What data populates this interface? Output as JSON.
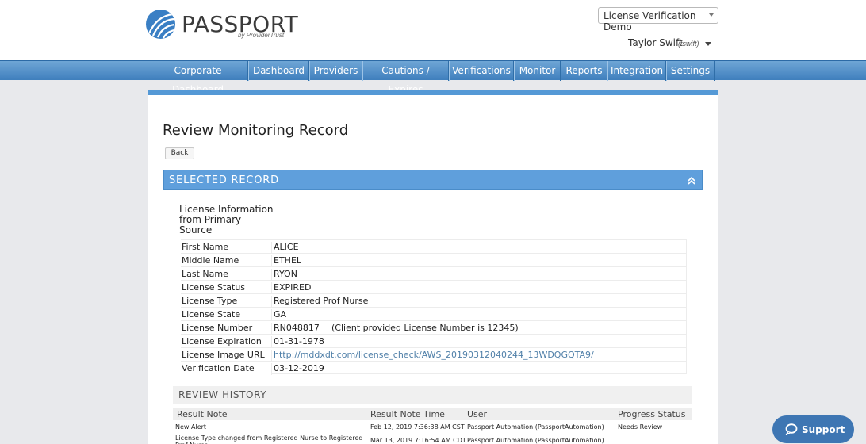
{
  "brand": {
    "name": "PASSPORT",
    "tagline": "by ProviderTrust"
  },
  "account": {
    "selected": "License Verification Demo"
  },
  "user": {
    "name": "Taylor Swift",
    "handle": "(tswift)"
  },
  "nav": [
    {
      "label": "Corporate Dashboard"
    },
    {
      "label": "Dashboard"
    },
    {
      "label": "Providers"
    },
    {
      "label": "Cautions / Expires"
    },
    {
      "label": "Verifications"
    },
    {
      "label": "Monitor"
    },
    {
      "label": "Reports"
    },
    {
      "label": "Integration"
    },
    {
      "label": "Settings"
    }
  ],
  "page": {
    "title": "Review Monitoring Record",
    "back_label": "Back"
  },
  "selected_record": {
    "title": "SELECTED RECORD",
    "heading": "License Information from Primary Source",
    "fields": [
      {
        "label": "First Name",
        "value": "ALICE"
      },
      {
        "label": "Middle Name",
        "value": "ETHEL"
      },
      {
        "label": "Last Name",
        "value": "RYON"
      },
      {
        "label": "License Status",
        "value": "EXPIRED"
      },
      {
        "label": "License Type",
        "value": "Registered Prof Nurse"
      },
      {
        "label": "License State",
        "value": "GA"
      },
      {
        "label": "License Number",
        "value": "RN048817",
        "extra": "(Client provided License Number is 12345)"
      },
      {
        "label": "License Expiration",
        "value": "01-31-1978"
      },
      {
        "label": "License Image URL",
        "value": "http://mddxdt.com/license_check/AWS_20190312040244_13WDQGQTA9/"
      },
      {
        "label": "Verification Date",
        "value": "03-12-2019"
      }
    ]
  },
  "review_history": {
    "title": "REVIEW HISTORY",
    "columns": [
      "Result Note",
      "Result Note Time",
      "User",
      "Progress Status"
    ],
    "rows": [
      [
        "New Alert",
        "Feb 12, 2019 7:36:38 AM CST",
        "Passport Automation (PassportAutomation)",
        "Needs Review"
      ],
      [
        "License Type changed from Registered Nurse to Registered Prof Nurse",
        "Mar 13, 2019 7:16:54 AM CDT",
        "Passport Automation (PassportAutomation)",
        ""
      ]
    ]
  },
  "support": {
    "label": "Support"
  }
}
